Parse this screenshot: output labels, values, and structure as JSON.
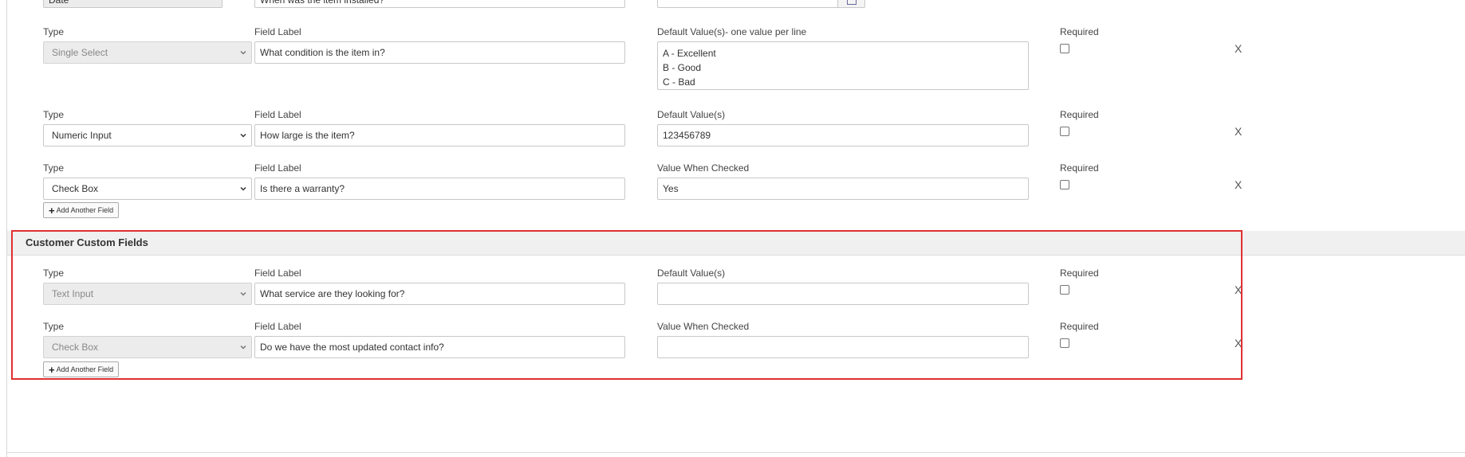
{
  "top_partial_row": {
    "type_value": "Date",
    "field_label_value": "When was the item installed?",
    "default_value": ""
  },
  "asset_fields": [
    {
      "type_label": "Type",
      "type_value": "Single Select",
      "field_label_label": "Field Label",
      "field_label_value": "What condition is the item in?",
      "default_label": "Default Value(s)- one value per line",
      "default_lines": [
        "A - Excellent",
        "B - Good",
        "C - Bad"
      ],
      "required_label": "Required",
      "remove": "X"
    },
    {
      "type_label": "Type",
      "type_value": "Numeric Input",
      "field_label_label": "Field Label",
      "field_label_value": "How large is the item?",
      "default_label": "Default Value(s)",
      "default_value": "123456789",
      "required_label": "Required",
      "remove": "X"
    },
    {
      "type_label": "Type",
      "type_value": "Check Box",
      "field_label_label": "Field Label",
      "field_label_value": "Is there a warranty?",
      "default_label": "Value When Checked",
      "default_value": "Yes",
      "required_label": "Required",
      "remove": "X"
    }
  ],
  "add_another_label": "Add Another Field",
  "customer_section": {
    "title": "Customer Custom Fields",
    "fields": [
      {
        "type_label": "Type",
        "type_value": "Text Input",
        "field_label_label": "Field Label",
        "field_label_value": "What service are they looking for?",
        "default_label": "Default Value(s)",
        "default_value": "",
        "required_label": "Required",
        "remove": "X"
      },
      {
        "type_label": "Type",
        "type_value": "Check Box",
        "field_label_label": "Field Label",
        "field_label_value": "Do we have the most updated contact info?",
        "default_label": "Value When Checked",
        "default_value": "",
        "required_label": "Required",
        "remove": "X"
      }
    ],
    "add_another_label": "Add Another Field"
  },
  "colors": {
    "highlight_border": "#e03030",
    "section_header_bg": "#f0f0f0",
    "disabled_select_bg": "#ececec"
  },
  "icons": [
    "chevron-down-icon",
    "plus-icon",
    "calendar-icon",
    "close-icon"
  ]
}
